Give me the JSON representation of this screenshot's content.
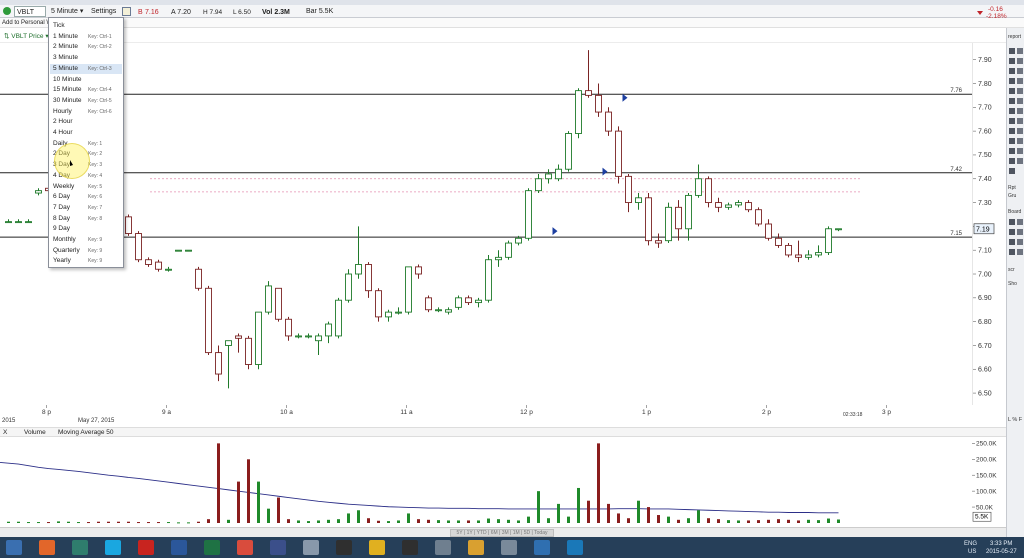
{
  "toolbar": {
    "symbol": "VBLT",
    "interval": "5 Minute",
    "settings_label": "Settings",
    "last_prefix": "B",
    "last_price": "7.16",
    "ask": "A 7.20",
    "high": "H 7.94",
    "low": "L 6.50",
    "volume": "Vol 2.3M",
    "bar": "Bar 5.5K",
    "change": "-0.16",
    "change_pct": "-2.18%"
  },
  "row2": {
    "add_to_label": "Add to Personal W"
  },
  "chart_legend": {
    "label": "VBLT Price"
  },
  "timeframe_menu": {
    "items": [
      {
        "label": "Tick",
        "key": ""
      },
      {
        "label": "1 Minute",
        "key": "Key: Ctrl-1"
      },
      {
        "label": "2 Minute",
        "key": "Key: Ctrl-2"
      },
      {
        "label": "3 Minute",
        "key": ""
      },
      {
        "label": "5 Minute",
        "key": "Key: Ctrl-3"
      },
      {
        "label": "10 Minute",
        "key": ""
      },
      {
        "label": "15 Minute",
        "key": "Key: Ctrl-4"
      },
      {
        "label": "30 Minute",
        "key": "Key: Ctrl-5"
      },
      {
        "label": "Hourly",
        "key": "Key: Ctrl-6"
      },
      {
        "label": "2 Hour",
        "key": ""
      },
      {
        "label": "4 Hour",
        "key": ""
      },
      {
        "label": "Daily",
        "key": "Key: 1"
      },
      {
        "label": "2 Day",
        "key": "Key: 2"
      },
      {
        "label": "3 Day",
        "key": "Key: 3"
      },
      {
        "label": "4 Day",
        "key": "Key: 4"
      },
      {
        "label": "Weekly",
        "key": "Key: 5"
      },
      {
        "label": "6 Day",
        "key": "Key: 6"
      },
      {
        "label": "7 Day",
        "key": "Key: 7"
      },
      {
        "label": "8 Day",
        "key": "Key: 8"
      },
      {
        "label": "9 Day",
        "key": ""
      },
      {
        "label": "Monthly",
        "key": "Key: 9"
      },
      {
        "label": "Quarterly",
        "key": "Key: 9"
      },
      {
        "label": "Yearly",
        "key": "Key: 9"
      }
    ],
    "selected": "5 Minute",
    "hovered": "3 Day"
  },
  "volume_header": {
    "x": "X",
    "volume_label": "Volume",
    "ma_label": "Moving Average 50"
  },
  "time_axis": {
    "extra_labels": [
      "2015",
      "May 27, 2015"
    ],
    "countdown": "02:33:18"
  },
  "scrollbar": {
    "thumb_text": "5Y | 1Y | YTD | 6M | 3M | 1M | 5D | Today"
  },
  "right_panel": {
    "top_label": "report",
    "rpt": "Rpt",
    "grp": "Gru",
    "board": "Board",
    "scr": "scr",
    "sho": "Sho",
    "lpf": "L % F"
  },
  "taskbar": {
    "apps": [
      "start-button",
      "firefox",
      "iq",
      "skype",
      "pdf",
      "word",
      "excel",
      "chrome-app",
      "obs",
      "calculator",
      "chart-app",
      "chrome",
      "chart-app-2",
      "media",
      "paint",
      "tool",
      "es",
      "ti"
    ],
    "lang": "ENG",
    "lang2": "US",
    "time": "3:33 PM",
    "date": "2015-05-27"
  },
  "chart_data": {
    "type": "candlestick",
    "series_name": "VBLT Price",
    "ylim": [
      6.45,
      7.97
    ],
    "y_ticks": [
      7.9,
      7.8,
      7.7,
      7.6,
      7.5,
      7.4,
      7.3,
      7.2,
      7.1,
      7.0,
      6.9,
      6.8,
      6.7,
      6.6,
      6.5
    ],
    "x_time_labels": [
      {
        "label": "6 p",
        "i": -3
      },
      {
        "label": "8 p",
        "i": 3
      },
      {
        "label": "9 a",
        "i": 15
      },
      {
        "label": "10 a",
        "i": 27
      },
      {
        "label": "11 a",
        "i": 39
      },
      {
        "label": "12 p",
        "i": 51
      },
      {
        "label": "1 p",
        "i": 63
      },
      {
        "label": "2 p",
        "i": 75
      },
      {
        "label": "3 p",
        "i": 87
      }
    ],
    "horizontal_levels": [
      {
        "label": "7.76",
        "value": 7.755
      },
      {
        "label": "7.42",
        "value": 7.425
      },
      {
        "label": "7.15",
        "value": 7.155
      }
    ],
    "dotted_levels": [
      7.4,
      7.345
    ],
    "last_price_tag": "7.19",
    "candles": [
      [
        7.22,
        7.23,
        7.22,
        7.22
      ],
      [
        7.22,
        7.23,
        7.22,
        7.22
      ],
      [
        7.22,
        7.23,
        7.22,
        7.22
      ],
      [
        7.34,
        7.36,
        7.33,
        7.35
      ],
      [
        7.36,
        7.36,
        7.34,
        7.35
      ],
      [
        7.44,
        7.44,
        7.43,
        7.44
      ],
      [
        7.51,
        7.52,
        7.5,
        7.51
      ],
      [
        7.55,
        7.56,
        7.54,
        7.55
      ],
      [
        7.55,
        7.55,
        7.53,
        7.54
      ],
      [
        7.5,
        7.5,
        7.49,
        7.49
      ],
      [
        7.5,
        7.51,
        7.41,
        7.42
      ],
      [
        7.42,
        7.43,
        7.23,
        7.24
      ],
      [
        7.24,
        7.25,
        7.16,
        7.17
      ],
      [
        7.17,
        7.18,
        7.05,
        7.06
      ],
      [
        7.06,
        7.07,
        7.03,
        7.04
      ],
      [
        7.05,
        7.06,
        7.01,
        7.02
      ],
      [
        7.02,
        7.03,
        7.01,
        7.02
      ],
      [
        7.1,
        7.1,
        7.1,
        7.1
      ],
      [
        7.1,
        7.1,
        7.1,
        7.1
      ],
      [
        7.02,
        7.03,
        6.93,
        6.94
      ],
      [
        6.94,
        6.95,
        6.66,
        6.67
      ],
      [
        6.67,
        6.7,
        6.55,
        6.58
      ],
      [
        6.7,
        6.71,
        6.52,
        6.72
      ],
      [
        6.74,
        6.75,
        6.67,
        6.73
      ],
      [
        6.73,
        6.74,
        6.6,
        6.62
      ],
      [
        6.62,
        6.84,
        6.6,
        6.84
      ],
      [
        6.84,
        6.97,
        6.83,
        6.95
      ],
      [
        6.94,
        6.94,
        6.8,
        6.81
      ],
      [
        6.81,
        6.82,
        6.72,
        6.74
      ],
      [
        6.74,
        6.75,
        6.73,
        6.74
      ],
      [
        6.74,
        6.75,
        6.73,
        6.74
      ],
      [
        6.72,
        6.75,
        6.66,
        6.74
      ],
      [
        6.74,
        6.8,
        6.71,
        6.79
      ],
      [
        6.74,
        6.9,
        6.73,
        6.89
      ],
      [
        6.89,
        7.02,
        6.88,
        7.0
      ],
      [
        7.0,
        7.2,
        6.98,
        7.04
      ],
      [
        7.04,
        7.05,
        6.9,
        6.93
      ],
      [
        6.93,
        6.94,
        6.8,
        6.82
      ],
      [
        6.82,
        6.85,
        6.8,
        6.84
      ],
      [
        6.84,
        6.86,
        6.83,
        6.84
      ],
      [
        6.84,
        7.03,
        6.83,
        7.03
      ],
      [
        7.03,
        7.04,
        6.98,
        7.0
      ],
      [
        6.9,
        6.91,
        6.84,
        6.85
      ],
      [
        6.85,
        6.86,
        6.84,
        6.85
      ],
      [
        6.84,
        6.86,
        6.83,
        6.85
      ],
      [
        6.86,
        6.91,
        6.85,
        6.9
      ],
      [
        6.9,
        6.91,
        6.87,
        6.88
      ],
      [
        6.88,
        6.9,
        6.86,
        6.89
      ],
      [
        6.89,
        7.08,
        6.88,
        7.06
      ],
      [
        7.06,
        7.1,
        7.03,
        7.07
      ],
      [
        7.07,
        7.14,
        7.06,
        7.13
      ],
      [
        7.13,
        7.16,
        7.12,
        7.15
      ],
      [
        7.15,
        7.36,
        7.14,
        7.35
      ],
      [
        7.35,
        7.42,
        7.34,
        7.4
      ],
      [
        7.4,
        7.44,
        7.38,
        7.42
      ],
      [
        7.4,
        7.46,
        7.39,
        7.44
      ],
      [
        7.44,
        7.6,
        7.43,
        7.59
      ],
      [
        7.59,
        7.78,
        7.57,
        7.77
      ],
      [
        7.77,
        7.94,
        7.74,
        7.75
      ],
      [
        7.75,
        7.8,
        7.66,
        7.68
      ],
      [
        7.68,
        7.7,
        7.58,
        7.6
      ],
      [
        7.6,
        7.62,
        7.38,
        7.41
      ],
      [
        7.41,
        7.42,
        7.26,
        7.3
      ],
      [
        7.3,
        7.34,
        7.27,
        7.32
      ],
      [
        7.32,
        7.34,
        7.12,
        7.14
      ],
      [
        7.14,
        7.17,
        7.11,
        7.13
      ],
      [
        7.14,
        7.3,
        7.13,
        7.28
      ],
      [
        7.28,
        7.31,
        7.14,
        7.19
      ],
      [
        7.19,
        7.34,
        7.14,
        7.33
      ],
      [
        7.33,
        7.46,
        7.32,
        7.4
      ],
      [
        7.4,
        7.41,
        7.28,
        7.3
      ],
      [
        7.3,
        7.32,
        7.26,
        7.28
      ],
      [
        7.28,
        7.3,
        7.27,
        7.29
      ],
      [
        7.29,
        7.31,
        7.28,
        7.3
      ],
      [
        7.3,
        7.31,
        7.26,
        7.27
      ],
      [
        7.27,
        7.28,
        7.2,
        7.21
      ],
      [
        7.21,
        7.23,
        7.14,
        7.15
      ],
      [
        7.15,
        7.17,
        7.11,
        7.12
      ],
      [
        7.12,
        7.13,
        7.07,
        7.08
      ],
      [
        7.08,
        7.14,
        7.05,
        7.07
      ],
      [
        7.07,
        7.1,
        7.06,
        7.08
      ],
      [
        7.08,
        7.12,
        7.07,
        7.09
      ],
      [
        7.09,
        7.2,
        7.08,
        7.19
      ],
      [
        7.19,
        7.19,
        7.18,
        7.19
      ]
    ],
    "volume": {
      "y_ticks": [
        "250.0K",
        "200.0K",
        "150.0K",
        "100.0K",
        "50.0K"
      ],
      "ylim": [
        0,
        270000
      ],
      "last_label": "5.5K",
      "values": [
        4000,
        4000,
        3000,
        3000,
        3000,
        5000,
        4000,
        3000,
        3000,
        4000,
        4000,
        4000,
        4000,
        3000,
        3000,
        3000,
        3000,
        2000,
        2000,
        4000,
        12000,
        250000,
        10000,
        130000,
        200000,
        130000,
        45000,
        80000,
        12000,
        8000,
        6000,
        8000,
        10000,
        12000,
        30000,
        40000,
        15000,
        7000,
        6000,
        8000,
        30000,
        12000,
        10000,
        9000,
        8000,
        8000,
        8000,
        8000,
        14000,
        12000,
        10000,
        8000,
        20000,
        100000,
        15000,
        60000,
        20000,
        110000,
        70000,
        250000,
        60000,
        30000,
        15000,
        70000,
        50000,
        25000,
        20000,
        10000,
        15000,
        40000,
        15000,
        12000,
        9000,
        8000,
        8000,
        9000,
        10000,
        12000,
        10000,
        8000,
        10000,
        9000,
        14000,
        11000
      ],
      "ma": [
        190000,
        185000,
        180000,
        175000,
        171000,
        168000,
        165000,
        162000,
        158000,
        154000,
        150000,
        147000,
        143000,
        140000,
        136000,
        132000,
        128000,
        124000,
        120000,
        116000,
        112000,
        108000,
        104000,
        100000,
        96000,
        92000,
        88000,
        84000,
        80000,
        76000,
        72000,
        68000,
        65000,
        62000,
        59000,
        57000,
        55000,
        53000,
        51000,
        50000,
        49000,
        48000,
        47000,
        47000,
        46000,
        46000,
        46000,
        45000,
        45000,
        45000,
        44000,
        44000,
        44000,
        44000,
        44000,
        44000,
        44000,
        44000,
        44000,
        44000,
        44000,
        45000,
        45000,
        45000,
        44000,
        44000,
        44000,
        43000,
        42000,
        41000,
        40000,
        39000,
        38000,
        37000,
        36000,
        35000,
        34000,
        34000,
        33000,
        33000,
        33000,
        32000,
        32000,
        32000
      ]
    }
  }
}
